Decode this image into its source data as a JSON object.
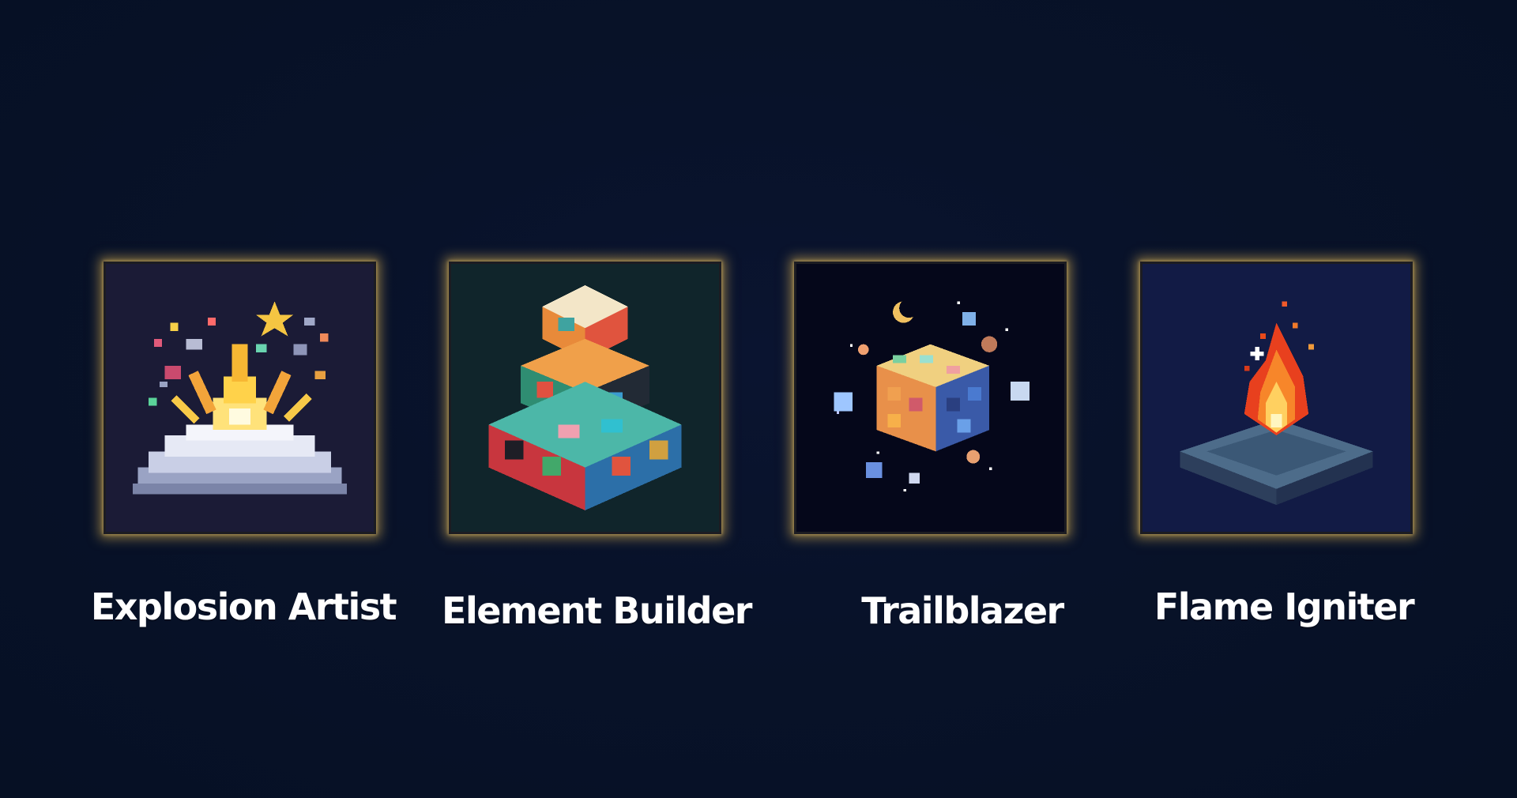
{
  "achievements": [
    {
      "title": "Explosion Artist",
      "icon": "explosion-icon",
      "status": "unlocked"
    },
    {
      "title": "Element Builder",
      "icon": "cube-tower-icon",
      "status": "unlocked"
    },
    {
      "title": "Trailblazer",
      "icon": "space-cube-icon",
      "status": "unlocked"
    },
    {
      "title": "Flame Igniter",
      "icon": "campfire-icon",
      "status": "unlocked"
    }
  ],
  "colors": {
    "background": "#081229",
    "glow": "#ecc056",
    "label": "#ffffff"
  }
}
